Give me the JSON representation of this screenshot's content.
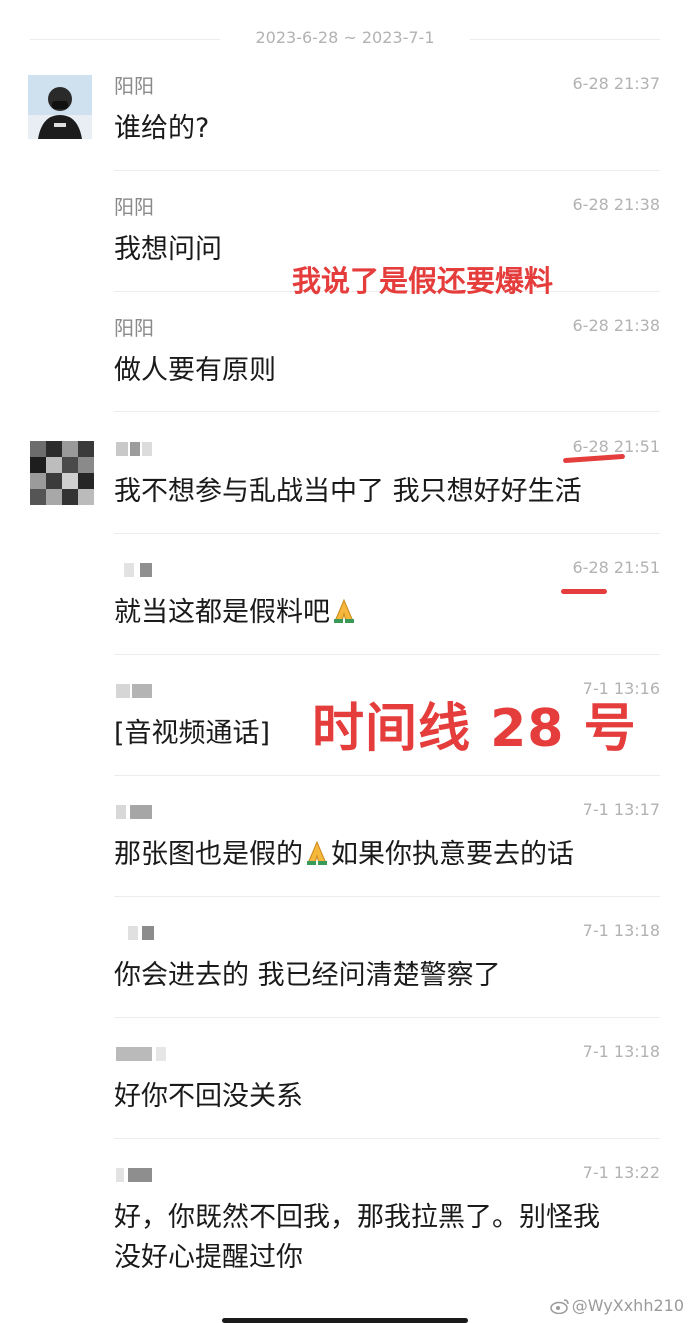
{
  "date_range": "2023-6-28 ~ 2023-7-1",
  "messages": [
    {
      "name": "阳阳",
      "time": "6-28 21:37",
      "text": "谁给的?"
    },
    {
      "name": "阳阳",
      "time": "6-28 21:38",
      "text": "我想问问"
    },
    {
      "name": "阳阳",
      "time": "6-28 21:38",
      "text": "做人要有原则"
    },
    {
      "name": "",
      "time": "6-28 21:51",
      "text": "我不想参与乱战当中了 我只想好好生活"
    },
    {
      "name": "",
      "time": "6-28 21:51",
      "text": "就当这都是假料吧"
    },
    {
      "name": "",
      "time": "7-1 13:16",
      "text": "[音视频通话]"
    },
    {
      "name": "",
      "time": "7-1 13:17",
      "text_before": "那张图也是假的",
      "text_after": "如果你执意要去的话"
    },
    {
      "name": "",
      "time": "7-1 13:18",
      "text": "你会进去的 我已经问清楚警察了"
    },
    {
      "name": "",
      "time": "7-1 13:18",
      "text": "好你不回没关系"
    },
    {
      "name": "",
      "time": "7-1 13:22",
      "text_line1": "好，你既然不回我，那我拉黑了。别怪我",
      "text_line2": "没好心提醒过你"
    }
  ],
  "annotations": {
    "fake_note": "我说了是假还要爆料",
    "timeline_note": "时间线 28 号"
  },
  "watermark": "@WyXxhh210",
  "colors": {
    "annotation": "#e53c3c",
    "meta_gray": "#b2b2b2",
    "name_gray": "#8a8a8a"
  },
  "icons": [
    "pray-emoji",
    "weibo-icon"
  ]
}
